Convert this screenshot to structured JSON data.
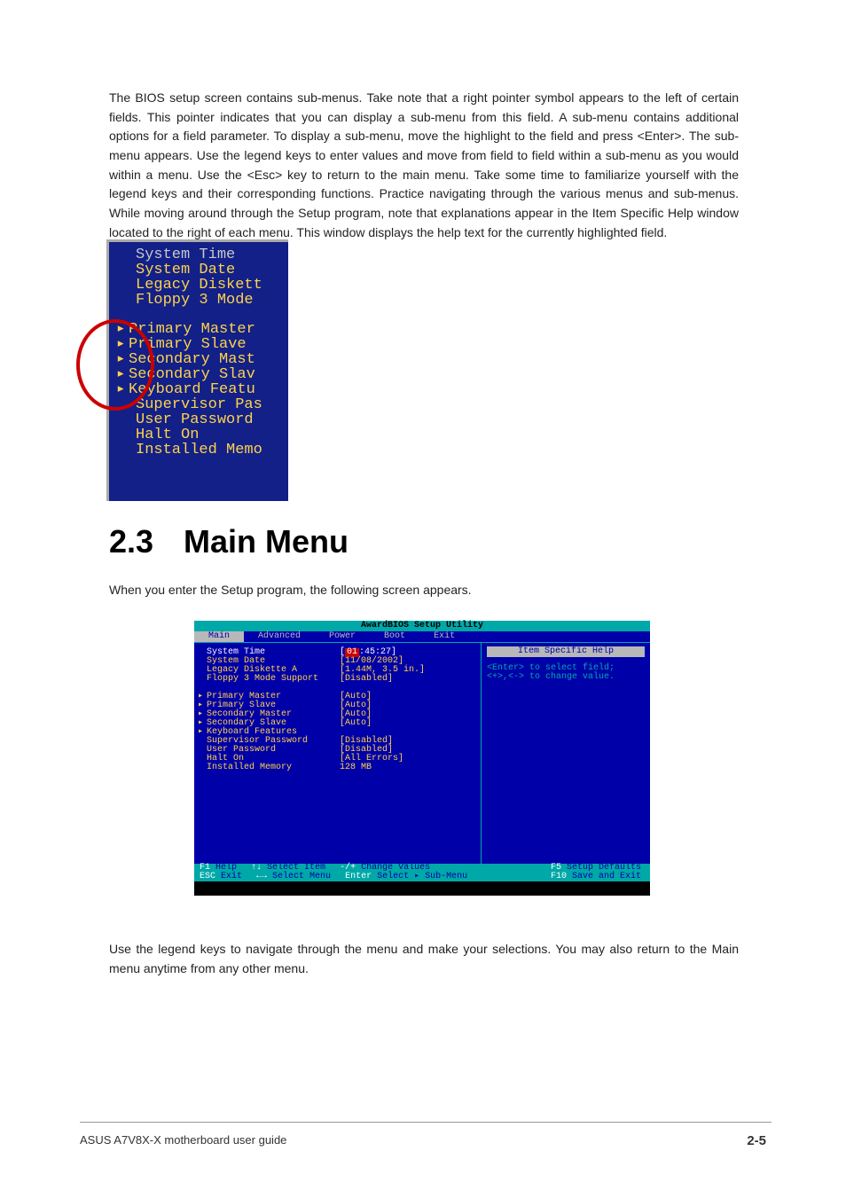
{
  "doc": {
    "para1": "The BIOS setup screen contains sub-menus. Take note that a right pointer symbol appears to the left of certain fields. This pointer indicates that you can display a sub-menu from this field. A sub-menu contains additional options for a field parameter. To display a sub-menu, move the highlight to the field and press <Enter>. The sub-menu appears. Use the legend keys to enter values and move from field to field within a sub-menu as you would within a menu. Use the <Esc> key to return to the main menu. Take some time to familiarize yourself with the legend keys and their corresponding functions. Practice navigating through the various menus and sub-menus. While moving around through the Setup program, note that explanations appear in the Item Specific Help window located to the right of each menu. This window displays the help text for the currently highlighted field.",
    "heading_num": "2.3",
    "heading_text": "Main Menu",
    "para2": "When you enter the Setup program, the following screen appears.",
    "para3": "Use the legend keys to navigate through the menu and make your selections. You may also return to the Main menu anytime from any other menu.",
    "footer_left": "ASUS A7V8X-X motherboard user guide",
    "footer_right": "2-5"
  },
  "cropped": {
    "l1": "System Time",
    "l2": "System Date",
    "l3": "Legacy Diskett",
    "l4": "Floppy 3 Mode",
    "l5": "Primary Master",
    "l6": "Primary Slave",
    "l7": "Secondary Mast",
    "l8": "Secondary Slav",
    "l9": "Keyboard Featu",
    "l10": "Supervisor Pas",
    "l11": "User Password",
    "l12": "Halt On",
    "l13": "Installed Memo"
  },
  "bios": {
    "title": "AwardBIOS Setup Utility",
    "tabs": {
      "main": "Main",
      "advanced": "Advanced",
      "power": "Power",
      "boot": "Boot",
      "exit": "Exit"
    },
    "rows": {
      "system_time_l": "System Time",
      "system_time_v": "01",
      "system_time_rest": ":45:27]",
      "system_date_l": "System Date",
      "system_date_v": "[11/08/2002]",
      "legacy_l": "Legacy Diskette A",
      "legacy_v": "[1.44M, 3.5 in.]",
      "floppy3_l": "Floppy 3 Mode Support",
      "floppy3_v": "[Disabled]",
      "pm_l": "Primary Master",
      "pm_v": "[Auto]",
      "ps_l": "Primary Slave",
      "ps_v": "[Auto]",
      "sm_l": "Secondary Master",
      "sm_v": "[Auto]",
      "ss_l": "Secondary Slave",
      "ss_v": "[Auto]",
      "kb_l": "Keyboard Features",
      "sup_l": "Supervisor Password",
      "sup_v": "[Disabled]",
      "usr_l": "User Password",
      "usr_v": "[Disabled]",
      "halt_l": "Halt On",
      "halt_v": "[All Errors]",
      "mem_l": "Installed Memory",
      "mem_v": "128 MB"
    },
    "help": {
      "title": "Item Specific Help",
      "text": "<Enter> to select field;\n<+>,<-> to change value."
    },
    "footer": {
      "r1": {
        "k1": "F1",
        "a1": "Help",
        "k2": "↑↓",
        "a2": "Select Item",
        "k3": "-/+",
        "a3": "Change Values",
        "k4": "F5",
        "a4": "Setup Defaults"
      },
      "r2": {
        "k1": "ESC",
        "a1": "Exit",
        "k2": "←→",
        "a2": "Select Menu",
        "k3": "Enter",
        "a3": "Select ▸ Sub-Menu",
        "k4": "F10",
        "a4": "Save and Exit"
      }
    }
  }
}
